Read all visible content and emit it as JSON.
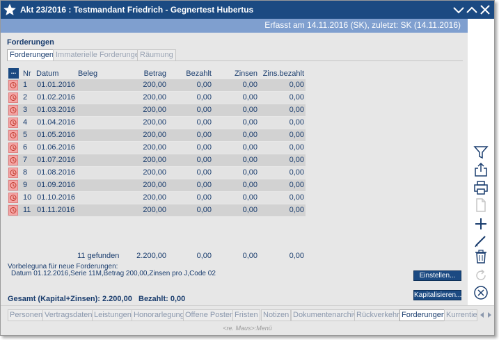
{
  "window": {
    "title": "Akt 23/2016 : Testmandant Friedrich - Gegnertest Hubertus",
    "captured": "Erfasst am 14.11.2016 (SK), zuletzt: SK (14.11.2016)"
  },
  "section": {
    "title": "Forderungen",
    "tabs": [
      "Forderungen",
      "Immaterielle Forderungen",
      "Räumung"
    ]
  },
  "table": {
    "menu_label": "...",
    "headers": [
      "Nr",
      "Datum",
      "Beleg",
      "Betrag",
      "Bezahlt",
      "Zinsen",
      "Zins.bezahlt"
    ],
    "rows": [
      {
        "nr": "1",
        "datum": "01.01.2016",
        "beleg": "",
        "betrag": "200,00",
        "bezahlt": "0,00",
        "zinsen": "0,00",
        "zins_bezahlt": "0,00"
      },
      {
        "nr": "2",
        "datum": "01.02.2016",
        "beleg": "",
        "betrag": "200,00",
        "bezahlt": "0,00",
        "zinsen": "0,00",
        "zins_bezahlt": "0,00"
      },
      {
        "nr": "3",
        "datum": "01.03.2016",
        "beleg": "",
        "betrag": "200,00",
        "bezahlt": "0,00",
        "zinsen": "0,00",
        "zins_bezahlt": "0,00"
      },
      {
        "nr": "4",
        "datum": "01.04.2016",
        "beleg": "",
        "betrag": "200,00",
        "bezahlt": "0,00",
        "zinsen": "0,00",
        "zins_bezahlt": "0,00"
      },
      {
        "nr": "5",
        "datum": "01.05.2016",
        "beleg": "",
        "betrag": "200,00",
        "bezahlt": "0,00",
        "zinsen": "0,00",
        "zins_bezahlt": "0,00"
      },
      {
        "nr": "6",
        "datum": "01.06.2016",
        "beleg": "",
        "betrag": "200,00",
        "bezahlt": "0,00",
        "zinsen": "0,00",
        "zins_bezahlt": "0,00"
      },
      {
        "nr": "7",
        "datum": "01.07.2016",
        "beleg": "",
        "betrag": "200,00",
        "bezahlt": "0,00",
        "zinsen": "0,00",
        "zins_bezahlt": "0,00"
      },
      {
        "nr": "8",
        "datum": "01.08.2016",
        "beleg": "",
        "betrag": "200,00",
        "bezahlt": "0,00",
        "zinsen": "0,00",
        "zins_bezahlt": "0,00"
      },
      {
        "nr": "9",
        "datum": "01.09.2016",
        "beleg": "",
        "betrag": "200,00",
        "bezahlt": "0,00",
        "zinsen": "0,00",
        "zins_bezahlt": "0,00"
      },
      {
        "nr": "10",
        "datum": "01.10.2016",
        "beleg": "",
        "betrag": "200,00",
        "bezahlt": "0,00",
        "zinsen": "0,00",
        "zins_bezahlt": "0,00"
      },
      {
        "nr": "11",
        "datum": "01.11.2016",
        "beleg": "",
        "betrag": "200,00",
        "bezahlt": "0,00",
        "zinsen": "0,00",
        "zins_bezahlt": "0,00"
      }
    ],
    "summary": {
      "found": "11 gefunden",
      "betrag": "2.200,00",
      "bezahlt": "0,00",
      "zinsen": "0,00",
      "zins_bezahlt": "0,00"
    }
  },
  "vorbelegung": {
    "title": "Vorbeleguna für neue Forderungen:",
    "text": "Datum 01.12.2016,Serie 11M,Betrag 200,00,Zinsen pro J,Code 02",
    "button": "Einstellen..."
  },
  "totals": {
    "gesamt": "Gesamt (Kapital+Zinsen): 2.200,00",
    "bezahlt": "Bezahlt: 0,00",
    "kapitalisieren_button": "Kapitalisieren..."
  },
  "bottom_tabs": [
    "Personen",
    "Vertragsdaten",
    "Leistungen",
    "Honorarlegung",
    "Offene Posten",
    "Fristen",
    "Notizen",
    "Dokumentenarchiv",
    "Rückverkehr",
    "Forderungen",
    "Kurrentier"
  ],
  "active_bottom_tab": "Forderungen",
  "status_hint": "<re. Maus>:Menü",
  "toolbar_icons": [
    "filter-icon",
    "export-icon",
    "print-icon",
    "document-icon",
    "add-icon",
    "edit-icon",
    "delete-icon",
    "refresh-icon",
    "close-circle-icon"
  ],
  "colors": {
    "titlebar": "#1b4a82",
    "infobar": "#7f9fcf",
    "row_icon": "#f4a6a6",
    "text": "#1a3d6e"
  }
}
